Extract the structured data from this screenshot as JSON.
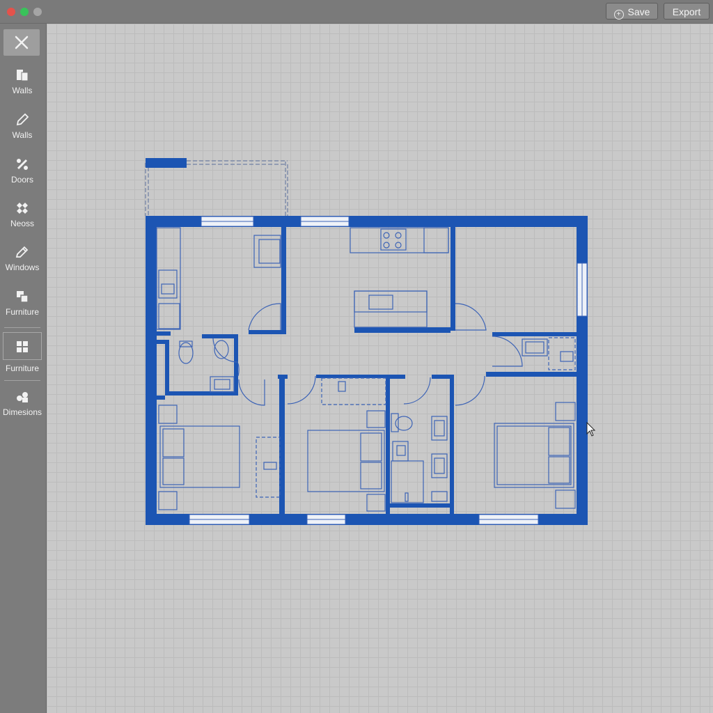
{
  "window": {
    "buttons": {
      "save_label": "Save",
      "export_label": "Export"
    }
  },
  "sidebar": {
    "tools": [
      {
        "label": "Walls",
        "icon": "walls-icon"
      },
      {
        "label": "Walls",
        "icon": "pencil-icon"
      },
      {
        "label": "Doors",
        "icon": "doors-icon"
      },
      {
        "label": "Neoss",
        "icon": "nodes-icon"
      },
      {
        "label": "Windows",
        "icon": "windows-icon"
      },
      {
        "label": "Furniture",
        "icon": "furniture-icon"
      },
      {
        "label": "Furniture",
        "icon": "grid-furniture-icon"
      },
      {
        "label": "Dimesions",
        "icon": "dimensions-icon"
      }
    ]
  },
  "colors": {
    "wall": "#1c55b3",
    "line": "#3c63b6",
    "canvas": "#c9c9c9",
    "sidebar": "#7c7c7c",
    "titlebar": "#7a7a7a"
  }
}
